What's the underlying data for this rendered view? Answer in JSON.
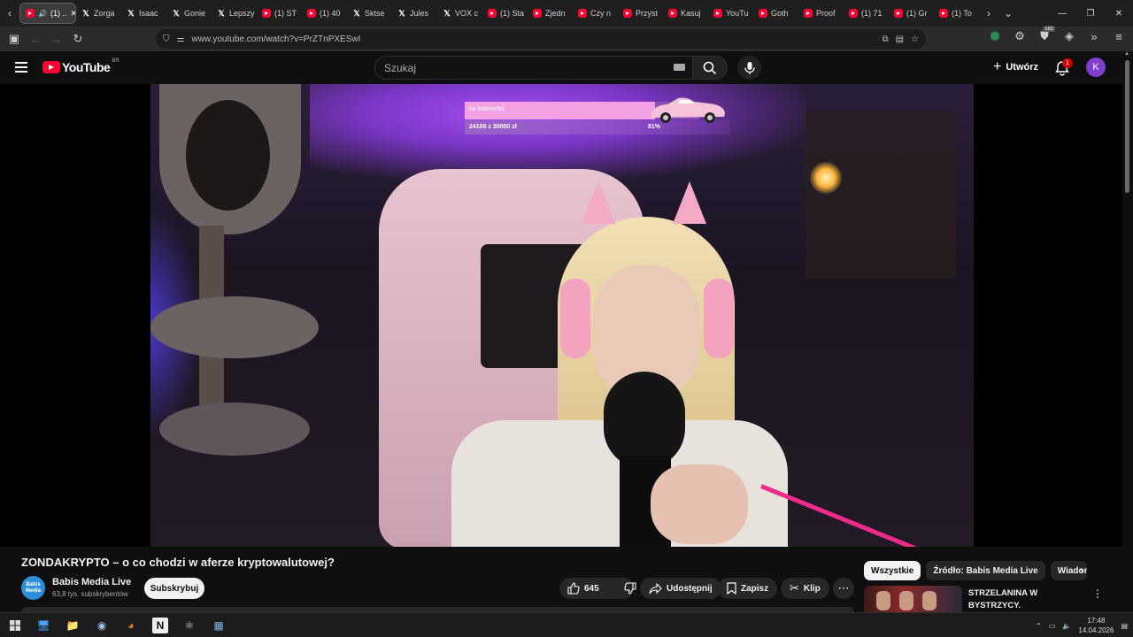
{
  "browser": {
    "tabs": [
      {
        "label": "(1) ..",
        "icon": "youtube",
        "active": true
      },
      {
        "label": "Zorga",
        "icon": "x"
      },
      {
        "label": "Isaac",
        "icon": "x"
      },
      {
        "label": "Gonie",
        "icon": "x"
      },
      {
        "label": "Lepszy",
        "icon": "x"
      },
      {
        "label": "(1) ST",
        "icon": "youtube"
      },
      {
        "label": "(1) 40",
        "icon": "youtube"
      },
      {
        "label": "Sktse",
        "icon": "x"
      },
      {
        "label": "Jules",
        "icon": "x"
      },
      {
        "label": "VOX c",
        "icon": "x"
      },
      {
        "label": "(1) Sta",
        "icon": "youtube"
      },
      {
        "label": "Zjedn",
        "icon": "youtube"
      },
      {
        "label": "Czy n",
        "icon": "youtube"
      },
      {
        "label": "Przyst",
        "icon": "youtube"
      },
      {
        "label": "Kasuj",
        "icon": "youtube"
      },
      {
        "label": "YouTu",
        "icon": "youtube"
      },
      {
        "label": "Goth",
        "icon": "youtube"
      },
      {
        "label": "Proof",
        "icon": "youtube"
      },
      {
        "label": "(1) 71",
        "icon": "youtube"
      },
      {
        "label": "(1) Gr",
        "icon": "youtube"
      },
      {
        "label": "(1) To",
        "icon": "youtube"
      }
    ],
    "url": "www.youtube.com/watch?v=PrZTnPXESwI",
    "extension_badge": "162"
  },
  "youtube": {
    "logo_text": "YouTube",
    "country_code": "BR",
    "search_placeholder": "Szukaj",
    "create_label": "Utwórz",
    "notification_count": "1",
    "avatar_letter": "K"
  },
  "overlay": {
    "goal_name": "na babimobil",
    "goal_amount": "24166 z 30000 zł",
    "goal_percent_text": "81%",
    "goal_progress": 0.81,
    "goal_fill_color": "#f4a1e4"
  },
  "video": {
    "title": "ZONDAKRYPTO – o co chodzi w aferze kryptowalutowej?",
    "channel_name": "Babis Media Live",
    "channel_avatar_text": "Babis Media",
    "subscribers": "63,8 tys. subskrybentów",
    "subscribe_label": "Subskrybuj",
    "likes": "645",
    "share_label": "Udostępnij",
    "save_label": "Zapisz",
    "clip_label": "Klip"
  },
  "sidebar": {
    "chips": [
      "Wszystkie",
      "Źródło: Babis Media Live",
      "Wiadomości"
    ],
    "recommendation_title": "STRZELANINA W BYSTRZYCY. ROZMAWIALIŚMY Z JEDNYM ..."
  },
  "taskbar": {
    "time": "17:48",
    "date": "14.04.2026"
  },
  "colors": {
    "youtube_red": "#ff0033",
    "background": "#0f0f0f",
    "avatar": "#7e3fd1"
  }
}
